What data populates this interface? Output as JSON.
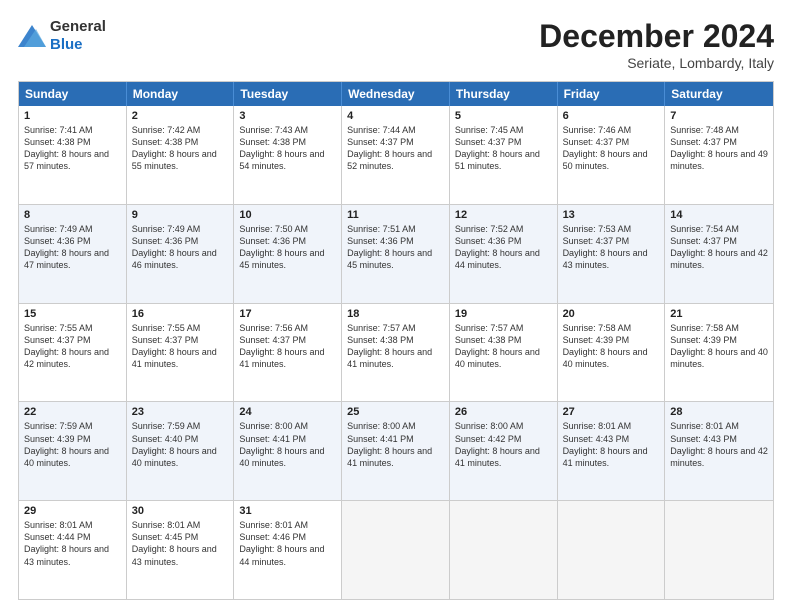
{
  "logo": {
    "general": "General",
    "blue": "Blue"
  },
  "title": "December 2024",
  "subtitle": "Seriate, Lombardy, Italy",
  "days": [
    "Sunday",
    "Monday",
    "Tuesday",
    "Wednesday",
    "Thursday",
    "Friday",
    "Saturday"
  ],
  "rows": [
    [
      {
        "day": "1",
        "sunrise": "Sunrise: 7:41 AM",
        "sunset": "Sunset: 4:38 PM",
        "daylight": "Daylight: 8 hours and 57 minutes."
      },
      {
        "day": "2",
        "sunrise": "Sunrise: 7:42 AM",
        "sunset": "Sunset: 4:38 PM",
        "daylight": "Daylight: 8 hours and 55 minutes."
      },
      {
        "day": "3",
        "sunrise": "Sunrise: 7:43 AM",
        "sunset": "Sunset: 4:38 PM",
        "daylight": "Daylight: 8 hours and 54 minutes."
      },
      {
        "day": "4",
        "sunrise": "Sunrise: 7:44 AM",
        "sunset": "Sunset: 4:37 PM",
        "daylight": "Daylight: 8 hours and 52 minutes."
      },
      {
        "day": "5",
        "sunrise": "Sunrise: 7:45 AM",
        "sunset": "Sunset: 4:37 PM",
        "daylight": "Daylight: 8 hours and 51 minutes."
      },
      {
        "day": "6",
        "sunrise": "Sunrise: 7:46 AM",
        "sunset": "Sunset: 4:37 PM",
        "daylight": "Daylight: 8 hours and 50 minutes."
      },
      {
        "day": "7",
        "sunrise": "Sunrise: 7:48 AM",
        "sunset": "Sunset: 4:37 PM",
        "daylight": "Daylight: 8 hours and 49 minutes."
      }
    ],
    [
      {
        "day": "8",
        "sunrise": "Sunrise: 7:49 AM",
        "sunset": "Sunset: 4:36 PM",
        "daylight": "Daylight: 8 hours and 47 minutes."
      },
      {
        "day": "9",
        "sunrise": "Sunrise: 7:49 AM",
        "sunset": "Sunset: 4:36 PM",
        "daylight": "Daylight: 8 hours and 46 minutes."
      },
      {
        "day": "10",
        "sunrise": "Sunrise: 7:50 AM",
        "sunset": "Sunset: 4:36 PM",
        "daylight": "Daylight: 8 hours and 45 minutes."
      },
      {
        "day": "11",
        "sunrise": "Sunrise: 7:51 AM",
        "sunset": "Sunset: 4:36 PM",
        "daylight": "Daylight: 8 hours and 45 minutes."
      },
      {
        "day": "12",
        "sunrise": "Sunrise: 7:52 AM",
        "sunset": "Sunset: 4:36 PM",
        "daylight": "Daylight: 8 hours and 44 minutes."
      },
      {
        "day": "13",
        "sunrise": "Sunrise: 7:53 AM",
        "sunset": "Sunset: 4:37 PM",
        "daylight": "Daylight: 8 hours and 43 minutes."
      },
      {
        "day": "14",
        "sunrise": "Sunrise: 7:54 AM",
        "sunset": "Sunset: 4:37 PM",
        "daylight": "Daylight: 8 hours and 42 minutes."
      }
    ],
    [
      {
        "day": "15",
        "sunrise": "Sunrise: 7:55 AM",
        "sunset": "Sunset: 4:37 PM",
        "daylight": "Daylight: 8 hours and 42 minutes."
      },
      {
        "day": "16",
        "sunrise": "Sunrise: 7:55 AM",
        "sunset": "Sunset: 4:37 PM",
        "daylight": "Daylight: 8 hours and 41 minutes."
      },
      {
        "day": "17",
        "sunrise": "Sunrise: 7:56 AM",
        "sunset": "Sunset: 4:37 PM",
        "daylight": "Daylight: 8 hours and 41 minutes."
      },
      {
        "day": "18",
        "sunrise": "Sunrise: 7:57 AM",
        "sunset": "Sunset: 4:38 PM",
        "daylight": "Daylight: 8 hours and 41 minutes."
      },
      {
        "day": "19",
        "sunrise": "Sunrise: 7:57 AM",
        "sunset": "Sunset: 4:38 PM",
        "daylight": "Daylight: 8 hours and 40 minutes."
      },
      {
        "day": "20",
        "sunrise": "Sunrise: 7:58 AM",
        "sunset": "Sunset: 4:39 PM",
        "daylight": "Daylight: 8 hours and 40 minutes."
      },
      {
        "day": "21",
        "sunrise": "Sunrise: 7:58 AM",
        "sunset": "Sunset: 4:39 PM",
        "daylight": "Daylight: 8 hours and 40 minutes."
      }
    ],
    [
      {
        "day": "22",
        "sunrise": "Sunrise: 7:59 AM",
        "sunset": "Sunset: 4:39 PM",
        "daylight": "Daylight: 8 hours and 40 minutes."
      },
      {
        "day": "23",
        "sunrise": "Sunrise: 7:59 AM",
        "sunset": "Sunset: 4:40 PM",
        "daylight": "Daylight: 8 hours and 40 minutes."
      },
      {
        "day": "24",
        "sunrise": "Sunrise: 8:00 AM",
        "sunset": "Sunset: 4:41 PM",
        "daylight": "Daylight: 8 hours and 40 minutes."
      },
      {
        "day": "25",
        "sunrise": "Sunrise: 8:00 AM",
        "sunset": "Sunset: 4:41 PM",
        "daylight": "Daylight: 8 hours and 41 minutes."
      },
      {
        "day": "26",
        "sunrise": "Sunrise: 8:00 AM",
        "sunset": "Sunset: 4:42 PM",
        "daylight": "Daylight: 8 hours and 41 minutes."
      },
      {
        "day": "27",
        "sunrise": "Sunrise: 8:01 AM",
        "sunset": "Sunset: 4:43 PM",
        "daylight": "Daylight: 8 hours and 41 minutes."
      },
      {
        "day": "28",
        "sunrise": "Sunrise: 8:01 AM",
        "sunset": "Sunset: 4:43 PM",
        "daylight": "Daylight: 8 hours and 42 minutes."
      }
    ],
    [
      {
        "day": "29",
        "sunrise": "Sunrise: 8:01 AM",
        "sunset": "Sunset: 4:44 PM",
        "daylight": "Daylight: 8 hours and 43 minutes."
      },
      {
        "day": "30",
        "sunrise": "Sunrise: 8:01 AM",
        "sunset": "Sunset: 4:45 PM",
        "daylight": "Daylight: 8 hours and 43 minutes."
      },
      {
        "day": "31",
        "sunrise": "Sunrise: 8:01 AM",
        "sunset": "Sunset: 4:46 PM",
        "daylight": "Daylight: 8 hours and 44 minutes."
      },
      null,
      null,
      null,
      null
    ]
  ]
}
